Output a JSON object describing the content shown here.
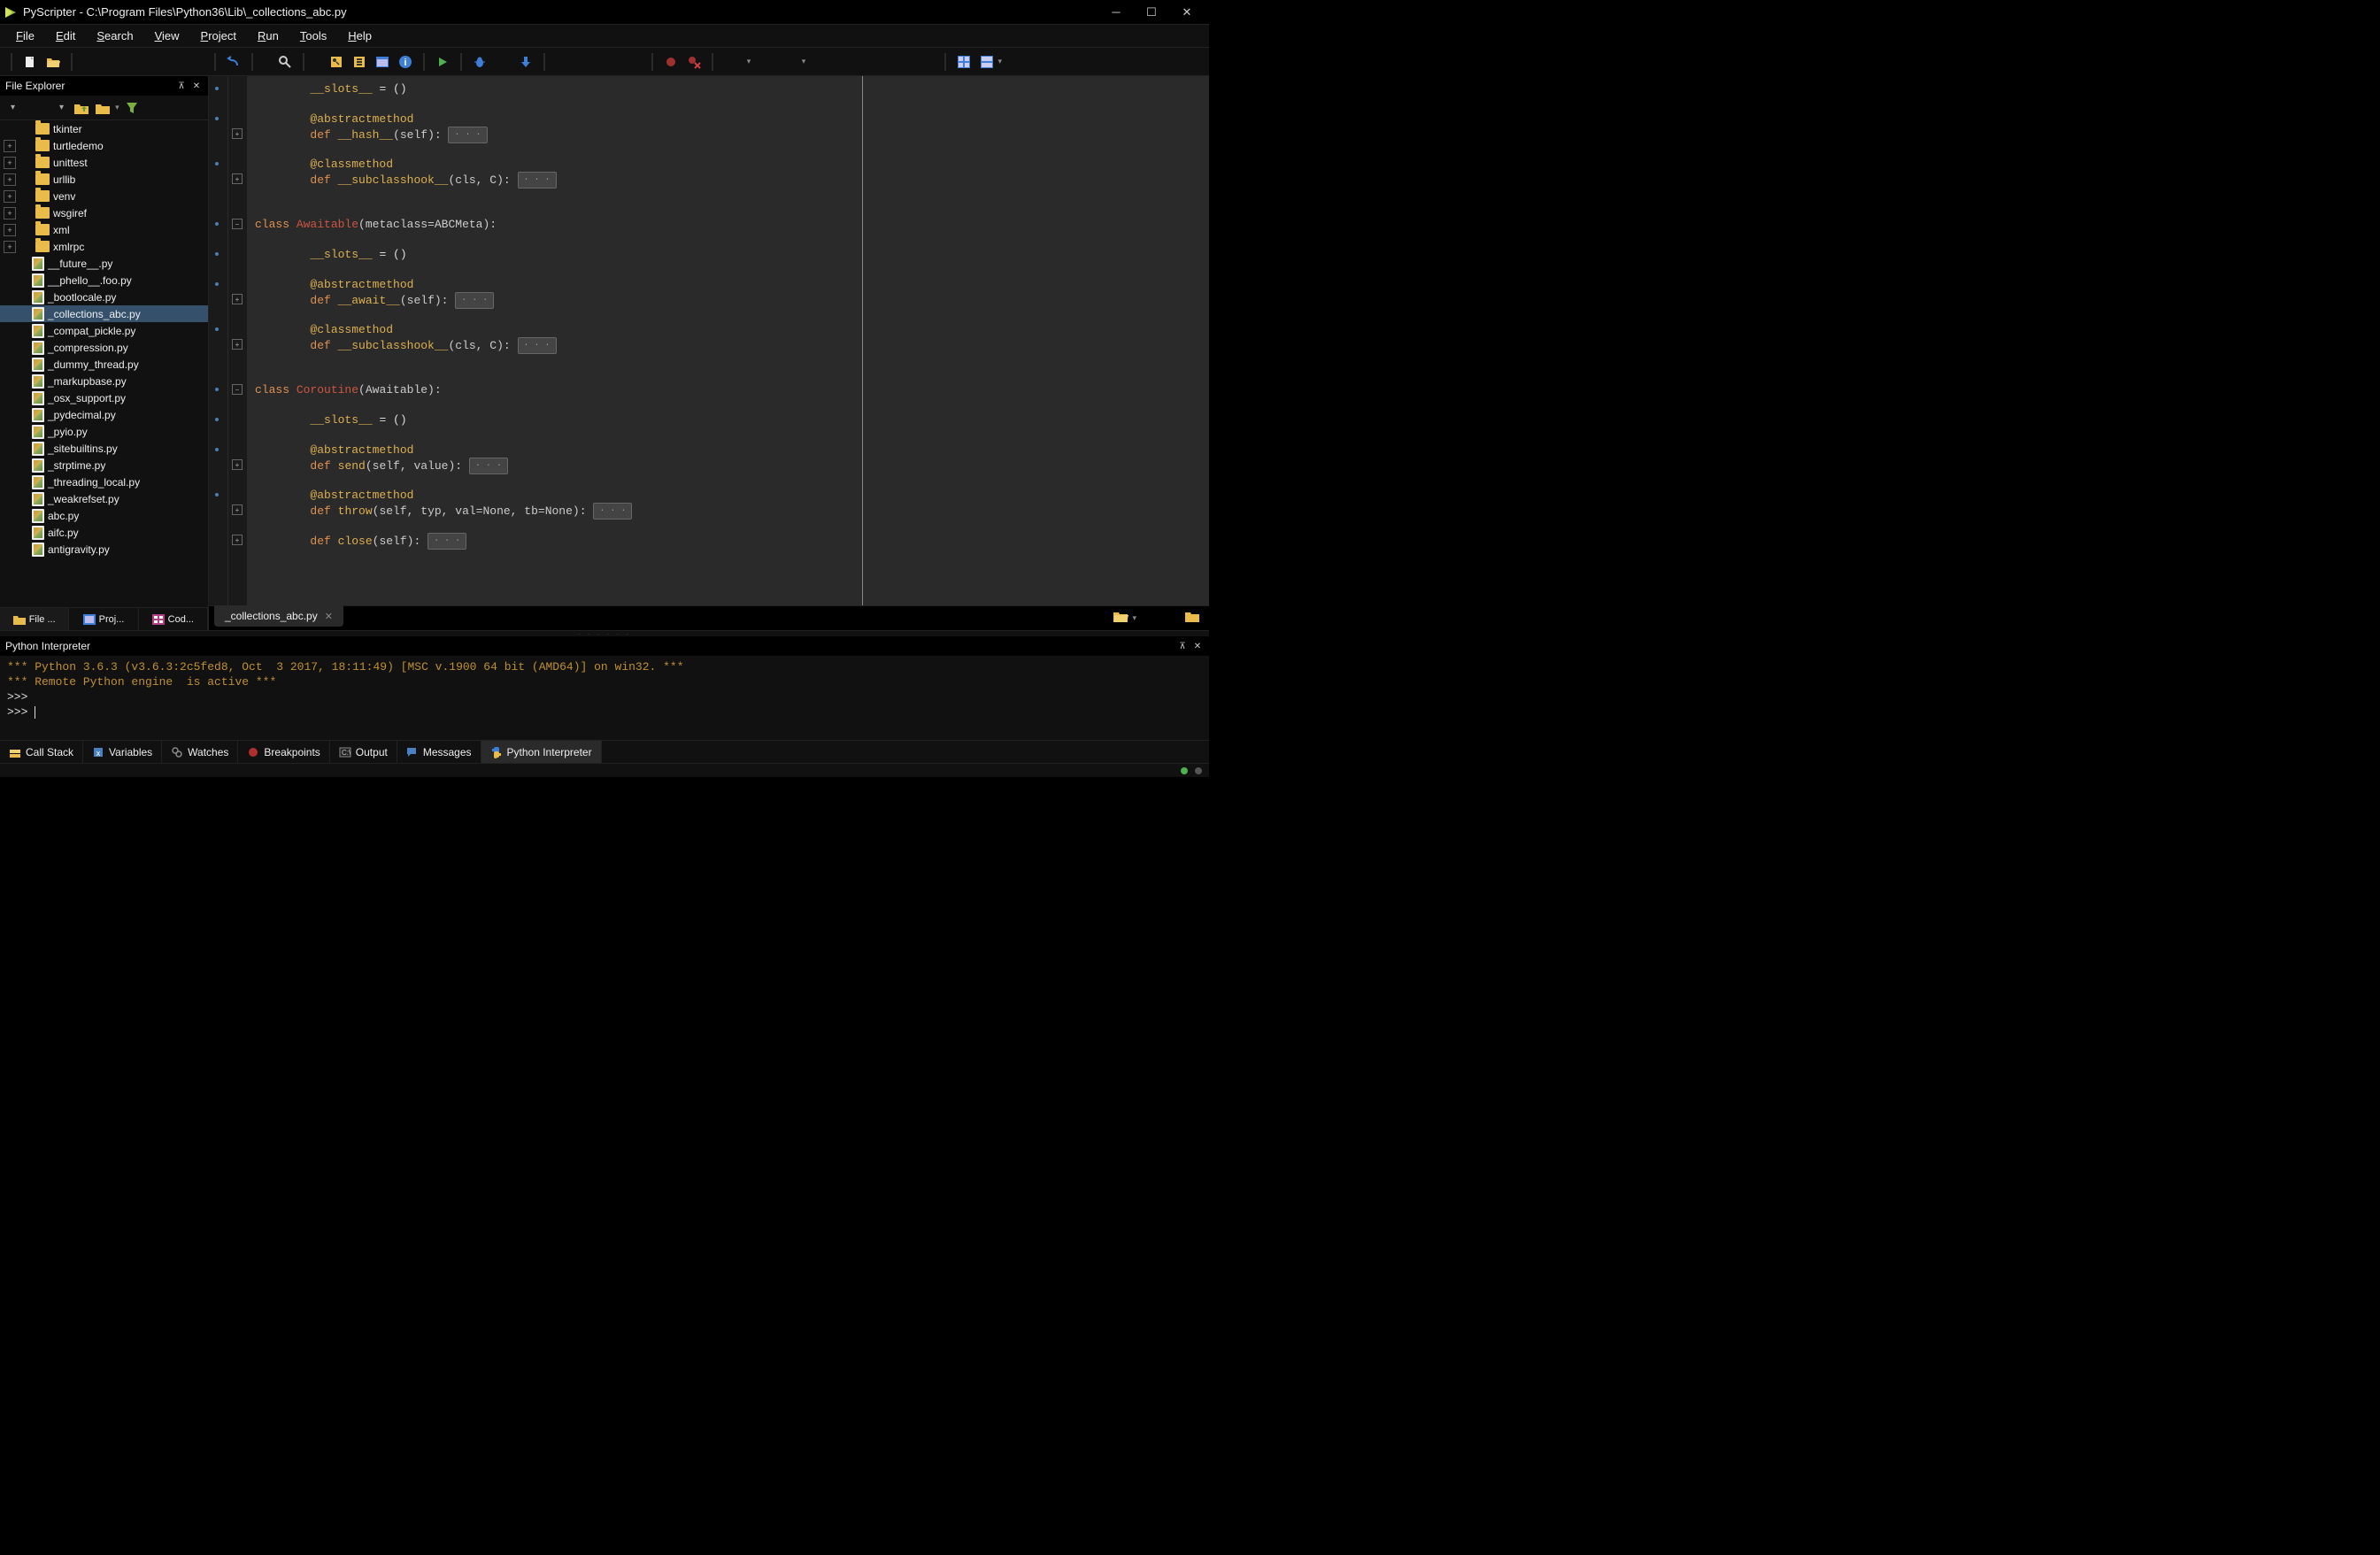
{
  "title": "PyScripter - C:\\Program Files\\Python36\\Lib\\_collections_abc.py",
  "menu": [
    "File",
    "Edit",
    "Search",
    "View",
    "Project",
    "Run",
    "Tools",
    "Help"
  ],
  "panels": {
    "file_explorer": "File Explorer",
    "interpreter": "Python Interpreter"
  },
  "tree": {
    "folders": [
      "tkinter",
      "turtledemo",
      "unittest",
      "urllib",
      "venv",
      "wsgiref",
      "xml",
      "xmlrpc"
    ],
    "files": [
      "__future__.py",
      "__phello__.foo.py",
      "_bootlocale.py",
      "_collections_abc.py",
      "_compat_pickle.py",
      "_compression.py",
      "_dummy_thread.py",
      "_markupbase.py",
      "_osx_support.py",
      "_pydecimal.py",
      "_pyio.py",
      "_sitebuiltins.py",
      "_strptime.py",
      "_threading_local.py",
      "_weakrefset.py",
      "abc.py",
      "aifc.py",
      "antigravity.py"
    ],
    "selected": "_collections_abc.py"
  },
  "left_tabs": [
    {
      "label": "File ..."
    },
    {
      "label": "Proj..."
    },
    {
      "label": "Cod..."
    }
  ],
  "editor_tab": "_collections_abc.py",
  "code_lines": [
    {
      "t": "slots",
      "indent": 2
    },
    {
      "t": "blank"
    },
    {
      "t": "dec",
      "txt": "@abstractmethod",
      "indent": 2
    },
    {
      "t": "def",
      "name": "__hash__",
      "args": "(self)",
      "fold": true,
      "indent": 2
    },
    {
      "t": "blank"
    },
    {
      "t": "dec",
      "txt": "@classmethod",
      "indent": 2
    },
    {
      "t": "def",
      "name": "__subclasshook__",
      "args": "(cls, C)",
      "fold": true,
      "indent": 2
    },
    {
      "t": "blank"
    },
    {
      "t": "blank"
    },
    {
      "t": "class",
      "name": "Awaitable",
      "args": "(metaclass=ABCMeta)"
    },
    {
      "t": "blank"
    },
    {
      "t": "slots",
      "indent": 2
    },
    {
      "t": "blank"
    },
    {
      "t": "dec",
      "txt": "@abstractmethod",
      "indent": 2
    },
    {
      "t": "def",
      "name": "__await__",
      "args": "(self)",
      "fold": true,
      "indent": 2
    },
    {
      "t": "blank"
    },
    {
      "t": "dec",
      "txt": "@classmethod",
      "indent": 2
    },
    {
      "t": "def",
      "name": "__subclasshook__",
      "args": "(cls, C)",
      "fold": true,
      "indent": 2
    },
    {
      "t": "blank"
    },
    {
      "t": "blank"
    },
    {
      "t": "class",
      "name": "Coroutine",
      "args": "(Awaitable)"
    },
    {
      "t": "blank"
    },
    {
      "t": "slots",
      "indent": 2
    },
    {
      "t": "blank"
    },
    {
      "t": "dec",
      "txt": "@abstractmethod",
      "indent": 2
    },
    {
      "t": "def",
      "name": "send",
      "args": "(self, value)",
      "fold": true,
      "indent": 2
    },
    {
      "t": "blank"
    },
    {
      "t": "dec",
      "txt": "@abstractmethod",
      "indent": 2
    },
    {
      "t": "def",
      "name": "throw",
      "args": "(self, typ, val=None, tb=None)",
      "fold": true,
      "indent": 2
    },
    {
      "t": "blank"
    },
    {
      "t": "def",
      "name": "close",
      "args": "(self)",
      "fold": true,
      "indent": 2
    }
  ],
  "interpreter": {
    "line1": "*** Python 3.6.3 (v3.6.3:2c5fed8, Oct  3 2017, 18:11:49) [MSC v.1900 64 bit (AMD64)] on win32. ***",
    "line2": "*** Remote Python engine  is active ***",
    "prompt": ">>>"
  },
  "bottom_tabs": [
    "Call Stack",
    "Variables",
    "Watches",
    "Breakpoints",
    "Output",
    "Messages",
    "Python Interpreter"
  ]
}
